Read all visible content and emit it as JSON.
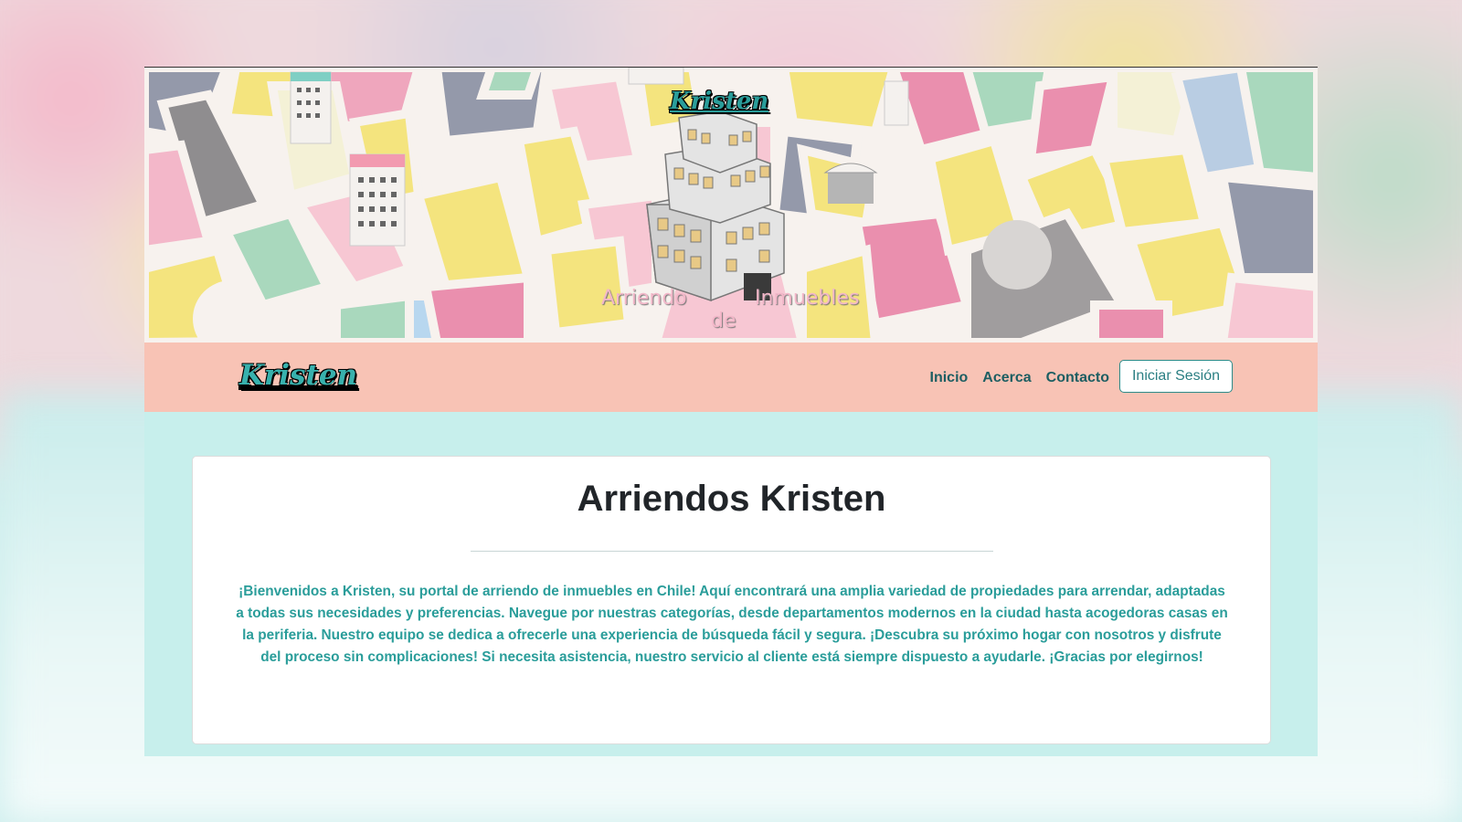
{
  "banner": {
    "logo_text": "Kristen",
    "tagline_words": [
      "Arriendo",
      "de",
      "Inmuebles"
    ]
  },
  "navbar": {
    "brand": "Kristen",
    "links": [
      "Inicio",
      "Acerca",
      "Contacto"
    ],
    "login_label": "Iniciar Sesión"
  },
  "main": {
    "title": "Arriendos Kristen",
    "intro": "¡Bienvenidos a Kristen, su portal de arriendo de inmuebles en Chile! Aquí encontrará una amplia variedad de propiedades para arrendar, adaptadas a todas sus necesidades y preferencias. Navegue por nuestras categorías, desde departamentos modernos en la ciudad hasta acogedoras casas en la periferia. Nuestro equipo se dedica a ofrecerle una experiencia de búsqueda fácil y segura. ¡Descubra su próximo hogar con nosotros y disfrute del proceso sin complicaciones! Si necesita asistencia, nuestro servicio al cliente está siempre dispuesto a ayudarle. ¡Gracias por elegirnos!"
  },
  "colors": {
    "navbar_bg": "#f8c3b5",
    "page_bg": "#c7efec",
    "accent_teal": "#2a9d9a",
    "nav_text": "#1d5e62"
  }
}
